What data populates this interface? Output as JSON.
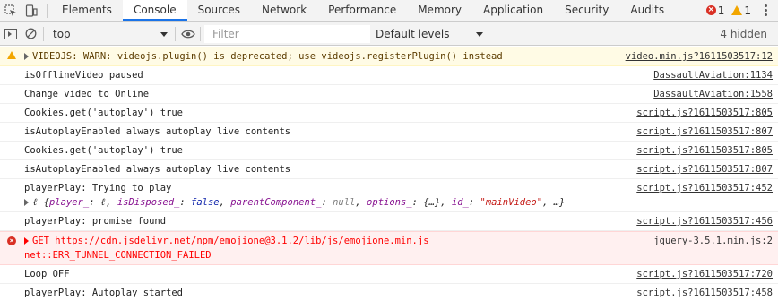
{
  "tabs": {
    "items": [
      "Elements",
      "Console",
      "Sources",
      "Network",
      "Performance",
      "Memory",
      "Application",
      "Security",
      "Audits"
    ],
    "active_index": 1,
    "error_count": "1",
    "warning_count": "1"
  },
  "toolbar": {
    "context": "top",
    "filter_placeholder": "Filter",
    "levels": "Default levels",
    "hidden": "4 hidden"
  },
  "messages": [
    {
      "level": "warning",
      "text": "VIDEOJS: WARN: videojs.plugin() is deprecated; use videojs.registerPlugin() instead",
      "source": "video.min.js?1611503517:12"
    },
    {
      "level": "info",
      "text": "isOfflineVideo paused",
      "source": "DassaultAviation:1134"
    },
    {
      "level": "info",
      "text": "Change video to Online",
      "source": "DassaultAviation:1558"
    },
    {
      "level": "info",
      "text": "Cookies.get('autoplay') true",
      "source": "script.js?1611503517:805"
    },
    {
      "level": "info",
      "text": "isAutoplayEnabled always autoplay live contents",
      "source": "script.js?1611503517:807"
    },
    {
      "level": "info",
      "text": "Cookies.get('autoplay') true",
      "source": "script.js?1611503517:805"
    },
    {
      "level": "info",
      "text": "isAutoplayEnabled always autoplay live contents",
      "source": "script.js?1611503517:807"
    },
    {
      "level": "info",
      "text": "playerPlay: Trying to play",
      "source": "script.js?1611503517:452"
    },
    {
      "level": "info",
      "text": "playerPlay: promise found",
      "source": "script.js?1611503517:456"
    },
    {
      "level": "error",
      "method": "GET",
      "url": "https://cdn.jsdelivr.net/npm/emojione@3.1.2/lib/js/emojione.min.js",
      "detail": "net::ERR_TUNNEL_CONNECTION_FAILED",
      "source": "jquery-3.5.1.min.js:2"
    },
    {
      "level": "info",
      "text": "Loop OFF",
      "source": "script.js?1611503517:720"
    },
    {
      "level": "info",
      "text": "playerPlay: Autoplay started",
      "source": "script.js?1611503517:458"
    }
  ],
  "object_preview": {
    "prefix": "ℓ {",
    "k1": "player_",
    "v1": ": ℓ, ",
    "k2": "isDisposed_",
    "v2": ": ",
    "v2b": "false",
    "v2c": ", ",
    "k3": "parentComponent_",
    "v3": ": ",
    "v3b": "null",
    "v3c": ", ",
    "k4": "options_",
    "v4": ": {…}, ",
    "k5": "id_",
    "v5": ": ",
    "v5b": "\"mainVideo\"",
    "suffix": ", …}"
  }
}
